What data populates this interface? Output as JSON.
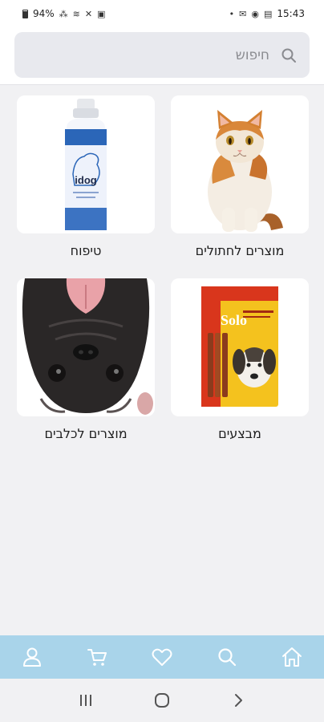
{
  "status_bar": {
    "battery": "94%",
    "time": "15:43"
  },
  "search": {
    "placeholder": "חיפוש",
    "icon": "search-icon"
  },
  "categories": [
    {
      "label": "מוצרים לחתולים",
      "image": "cat-photo"
    },
    {
      "label": "טיפוח",
      "image": "shampoo-bottle-photo",
      "product_text": "idog"
    },
    {
      "label": "מבצעים",
      "image": "dog-treats-pack-photo",
      "product_text": "Solo"
    },
    {
      "label": "מוצרים לכלבים",
      "image": "pug-photo"
    }
  ],
  "bottom_nav": {
    "items": [
      "home-icon",
      "search-icon",
      "heart-icon",
      "cart-icon",
      "user-icon"
    ],
    "background": "#a9d4ea",
    "icon_color": "#ffffff"
  },
  "system_nav": {
    "items": [
      "recents-icon",
      "home-circle-icon",
      "back-icon"
    ]
  }
}
